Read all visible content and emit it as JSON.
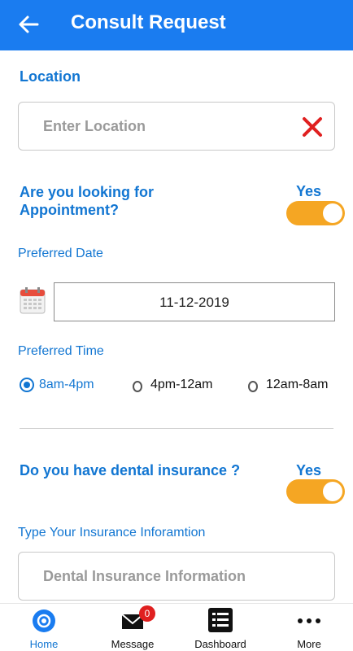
{
  "header": {
    "title": "Consult Request"
  },
  "location": {
    "title": "Location",
    "placeholder": "Enter Location"
  },
  "appointment": {
    "question": "Are you looking for Appointment?",
    "toggle_label": "Yes",
    "toggle_on": true
  },
  "preferred_date": {
    "label": "Preferred Date",
    "value": "11-12-2019"
  },
  "preferred_time": {
    "label": "Preferred Time",
    "options": [
      {
        "label": "8am-4pm",
        "selected": true
      },
      {
        "label": "4pm-12am",
        "selected": false
      },
      {
        "label": "12am-8am",
        "selected": false
      }
    ]
  },
  "dental": {
    "question": "Do you have dental insurance ?",
    "toggle_label": "Yes",
    "toggle_on": true,
    "info_label": "Type Your Insurance Inforamtion",
    "info_placeholder": "Dental Insurance Information"
  },
  "nav": {
    "items": [
      {
        "label": "Home",
        "icon": "home-target-icon",
        "active": true
      },
      {
        "label": "Message",
        "icon": "envelope-icon",
        "badge": "0"
      },
      {
        "label": "Dashboard",
        "icon": "list-icon"
      },
      {
        "label": "More",
        "icon": "more-dots-icon"
      }
    ]
  },
  "colors": {
    "primary": "#1a7cf0",
    "accent_text": "#1276d2",
    "toggle": "#f5a623",
    "clear": "#e02020"
  }
}
